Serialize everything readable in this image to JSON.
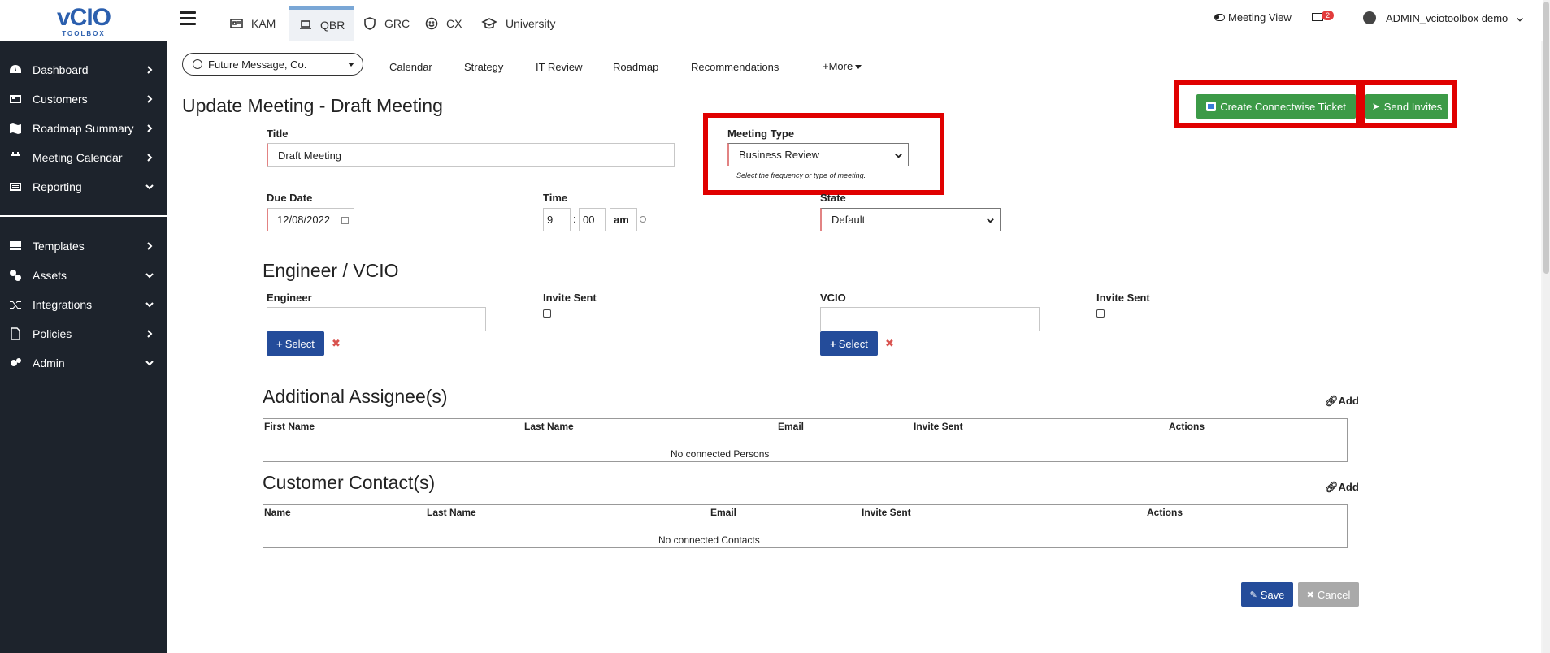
{
  "brand": {
    "logo_text": "vCIO",
    "logo_sub": "TOOLBOX"
  },
  "sidebar": {
    "items": [
      {
        "label": "Dashboard",
        "icon": "dashboard-icon"
      },
      {
        "label": "Customers",
        "icon": "customers-icon"
      },
      {
        "label": "Roadmap Summary",
        "icon": "map-icon"
      },
      {
        "label": "Meeting Calendar",
        "icon": "calendar-icon"
      },
      {
        "label": "Reporting",
        "icon": "reporting-icon"
      },
      {
        "label": "Templates",
        "icon": "templates-icon"
      },
      {
        "label": "Assets",
        "icon": "assets-icon"
      },
      {
        "label": "Integrations",
        "icon": "integrations-icon"
      },
      {
        "label": "Policies",
        "icon": "policies-icon"
      },
      {
        "label": "Admin",
        "icon": "gear-icon"
      }
    ]
  },
  "topbar": {
    "tabs": [
      {
        "label": "KAM",
        "icon": "id-card-icon"
      },
      {
        "label": "QBR",
        "icon": "laptop-icon",
        "active": true
      },
      {
        "label": "GRC",
        "icon": "shield-icon"
      },
      {
        "label": "CX",
        "icon": "smile-icon"
      },
      {
        "label": "University",
        "icon": "graduation-cap-icon"
      }
    ],
    "meeting_view": "Meeting View",
    "mail_count": "2",
    "user": "ADMIN_vciotoolbox demo"
  },
  "customer": {
    "selected": "Future Message, Co."
  },
  "subnav": {
    "items": [
      "Calendar",
      "Strategy",
      "IT Review",
      "Roadmap",
      "Recommendations",
      "+More"
    ]
  },
  "page": {
    "title": "Update Meeting - Draft Meeting"
  },
  "actions": {
    "create_ticket": "Create Connectwise Ticket",
    "send_invites": "Send Invites"
  },
  "form": {
    "title_label": "Title",
    "title_value": "Draft Meeting",
    "meeting_type_label": "Meeting Type",
    "meeting_type_value": "Business Review",
    "meeting_type_hint": "Select the frequency or type of meeting.",
    "due_date_label": "Due Date",
    "due_date_value": "12/08/2022",
    "time_label": "Time",
    "time_hour": "9",
    "time_sep": ":",
    "time_min": "00",
    "time_ampm": "am",
    "state_label": "State",
    "state_value": "Default"
  },
  "engineer_section": {
    "heading": "Engineer / VCIO",
    "engineer_label": "Engineer",
    "invite_sent_label": "Invite Sent",
    "vcio_label": "VCIO",
    "select_label": "Select"
  },
  "assignees": {
    "heading": "Additional Assignee(s)",
    "add_label": "Add",
    "columns": [
      "First Name",
      "Last Name",
      "Email",
      "Invite Sent",
      "Actions"
    ],
    "empty": "No connected Persons"
  },
  "contacts": {
    "heading": "Customer Contact(s)",
    "add_label": "Add",
    "columns": [
      "Name",
      "Last Name",
      "Email",
      "Invite Sent",
      "Actions"
    ],
    "empty": "No connected Contacts"
  },
  "footer": {
    "save": "Save",
    "cancel": "Cancel"
  },
  "colors": {
    "sidebar": "#1d232c",
    "primary": "#244c9a",
    "success": "#3c9a47",
    "highlight": "#e00000"
  }
}
